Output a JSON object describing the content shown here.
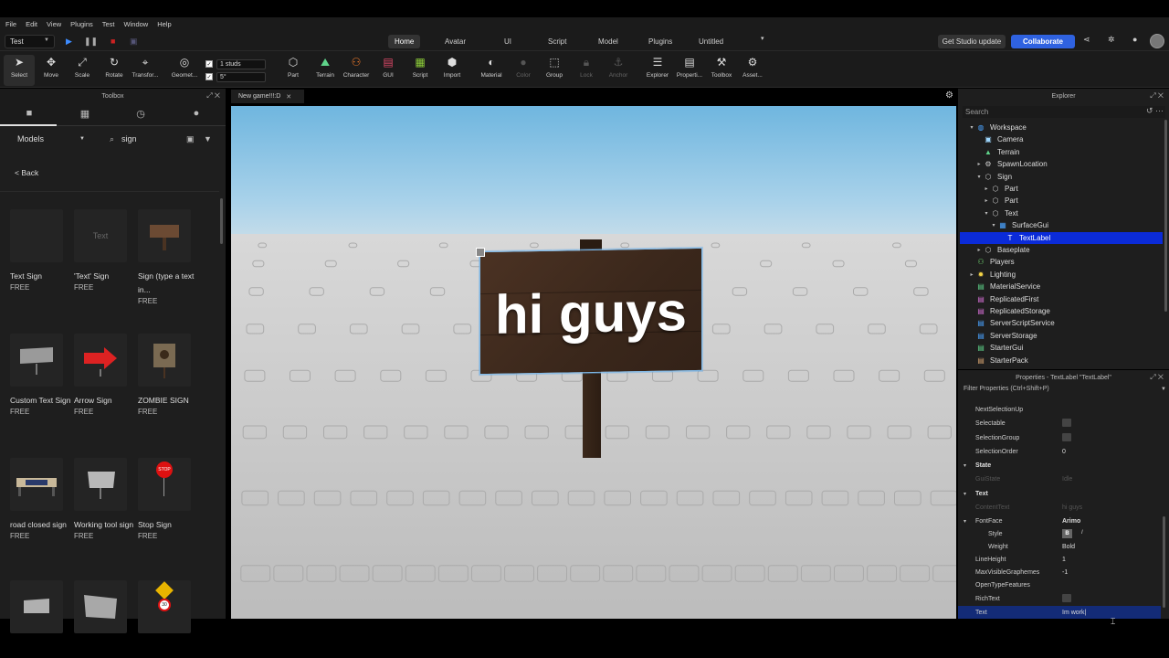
{
  "menu": [
    "File",
    "Edit",
    "View",
    "Plugins",
    "Test",
    "Window",
    "Help"
  ],
  "ribbon": {
    "mode": "Test",
    "tabs": [
      "Home",
      "Avatar",
      "UI",
      "Script",
      "Model",
      "Plugins",
      "Untitled"
    ],
    "update_label": "Get Studio update",
    "collaborate_label": "Collaborate"
  },
  "toolbar": {
    "select": "Select",
    "move": "Move",
    "scale": "Scale",
    "rotate": "Rotate",
    "transform": "Transfor...",
    "geometry": "Geomet...",
    "studs": "1 studs",
    "degrees": "5°",
    "part": "Part",
    "terrain": "Terrain",
    "character": "Character",
    "gui": "GUI",
    "script": "Script",
    "import": "Import",
    "material": "Material",
    "color": "Color",
    "group": "Group",
    "lock": "Lock",
    "anchor": "Anchor",
    "explorer": "Explorer",
    "properties": "Properti...",
    "toolbox": "Toolbox",
    "asset": "Asset..."
  },
  "toolbox": {
    "title": "Toolbox",
    "category": "Models",
    "search": "sign",
    "back": "< Back",
    "items": [
      {
        "name": "Text Sign",
        "price": "FREE",
        "thumb_text": ""
      },
      {
        "name": "'Text' Sign",
        "price": "FREE",
        "thumb_text": "Text"
      },
      {
        "name": "Sign (type a text in...",
        "price": "FREE",
        "thumb_text": ""
      },
      {
        "name": "Custom Text Sign",
        "price": "FREE",
        "thumb_text": ""
      },
      {
        "name": "Arrow Sign",
        "price": "FREE",
        "thumb_text": ""
      },
      {
        "name": "ZOMBIE SIGN",
        "price": "FREE",
        "thumb_text": ""
      },
      {
        "name": "road closed sign",
        "price": "FREE",
        "thumb_text": ""
      },
      {
        "name": "Working tool sign",
        "price": "FREE",
        "thumb_text": ""
      },
      {
        "name": "Stop Sign",
        "price": "FREE",
        "thumb_text": "STOP"
      },
      {
        "name": "",
        "price": "",
        "thumb_text": ""
      },
      {
        "name": "",
        "price": "",
        "thumb_text": ""
      },
      {
        "name": "",
        "price": "",
        "thumb_text": "30"
      }
    ]
  },
  "viewport": {
    "doc_tab": "New game!!!:D",
    "sign_text": "hi guys"
  },
  "explorer": {
    "title": "Explorer",
    "search_placeholder": "Search",
    "tree": [
      {
        "label": "Workspace",
        "icon": "globe-icon",
        "color": "#4aa3ff",
        "expanded": "▾"
      },
      {
        "label": "Camera",
        "icon": "camera-icon",
        "color": "#9fd8ff",
        "expanded": ""
      },
      {
        "label": "Terrain",
        "icon": "terrain-icon",
        "color": "#5fd38a",
        "expanded": ""
      },
      {
        "label": "SpawnLocation",
        "icon": "spawn-icon",
        "color": "#cccccc",
        "expanded": "▸"
      },
      {
        "label": "Sign",
        "icon": "model-icon",
        "color": "#cccccc",
        "expanded": "▾"
      },
      {
        "label": "Part",
        "icon": "part-icon",
        "color": "#cccccc",
        "expanded": "▸"
      },
      {
        "label": "Part",
        "icon": "part-icon",
        "color": "#cccccc",
        "expanded": "▸"
      },
      {
        "label": "Text",
        "icon": "part-icon",
        "color": "#cccccc",
        "expanded": "▾"
      },
      {
        "label": "SurfaceGui",
        "icon": "surfacegui-icon",
        "color": "#4aa3ff",
        "expanded": "▾"
      },
      {
        "label": "TextLabel",
        "icon": "textlabel-icon",
        "color": "#ffffff",
        "expanded": ""
      },
      {
        "label": "Baseplate",
        "icon": "part-icon",
        "color": "#cccccc",
        "expanded": "▸"
      },
      {
        "label": "Players",
        "icon": "players-icon",
        "color": "#6fd36f",
        "expanded": ""
      },
      {
        "label": "Lighting",
        "icon": "lighting-icon",
        "color": "#f5d547",
        "expanded": "▸"
      },
      {
        "label": "MaterialService",
        "icon": "service-icon",
        "color": "#5fd38a",
        "expanded": ""
      },
      {
        "label": "ReplicatedFirst",
        "icon": "service-icon",
        "color": "#d36fd3",
        "expanded": ""
      },
      {
        "label": "ReplicatedStorage",
        "icon": "service-icon",
        "color": "#d36fd3",
        "expanded": ""
      },
      {
        "label": "ServerScriptService",
        "icon": "service-icon",
        "color": "#4aa3ff",
        "expanded": ""
      },
      {
        "label": "ServerStorage",
        "icon": "service-icon",
        "color": "#4aa3ff",
        "expanded": ""
      },
      {
        "label": "StarterGui",
        "icon": "service-icon",
        "color": "#5fd38a",
        "expanded": ""
      },
      {
        "label": "StarterPack",
        "icon": "service-icon",
        "color": "#d3a16f",
        "expanded": ""
      }
    ]
  },
  "properties": {
    "title": "Properties - TextLabel \"TextLabel\"",
    "filter": "Filter Properties (Ctrl+Shift+P)",
    "rows": [
      {
        "name": "NextSelectionUp",
        "value": "",
        "kind": "value"
      },
      {
        "name": "Selectable",
        "value": "",
        "kind": "checkbox"
      },
      {
        "name": "SelectionGroup",
        "value": "",
        "kind": "checkbox"
      },
      {
        "name": "SelectionOrder",
        "value": "0",
        "kind": "value"
      },
      {
        "name": "State",
        "value": "",
        "kind": "section"
      },
      {
        "name": "GuiState",
        "value": "Idle",
        "kind": "dim"
      },
      {
        "name": "Text",
        "value": "",
        "kind": "section"
      },
      {
        "name": "ContentText",
        "value": "hi guys",
        "kind": "dim"
      },
      {
        "name": "FontFace",
        "value": "Arimo",
        "kind": "expand"
      },
      {
        "name": "Style",
        "value": "",
        "kind": "style"
      },
      {
        "name": "Weight",
        "value": "Bold",
        "kind": "sub"
      },
      {
        "name": "LineHeight",
        "value": "1",
        "kind": "value"
      },
      {
        "name": "MaxVisibleGraphemes",
        "value": "-1",
        "kind": "value"
      },
      {
        "name": "OpenTypeFeatures",
        "value": "",
        "kind": "value"
      },
      {
        "name": "RichText",
        "value": "",
        "kind": "checkbox"
      },
      {
        "name": "Text",
        "value": "Im work|",
        "kind": "active"
      }
    ],
    "style_bold": "B",
    "style_italic": "I"
  },
  "colors": {
    "accent": "#2f62e0",
    "selection": "#0b2bd8",
    "sign": "#3a271b"
  }
}
